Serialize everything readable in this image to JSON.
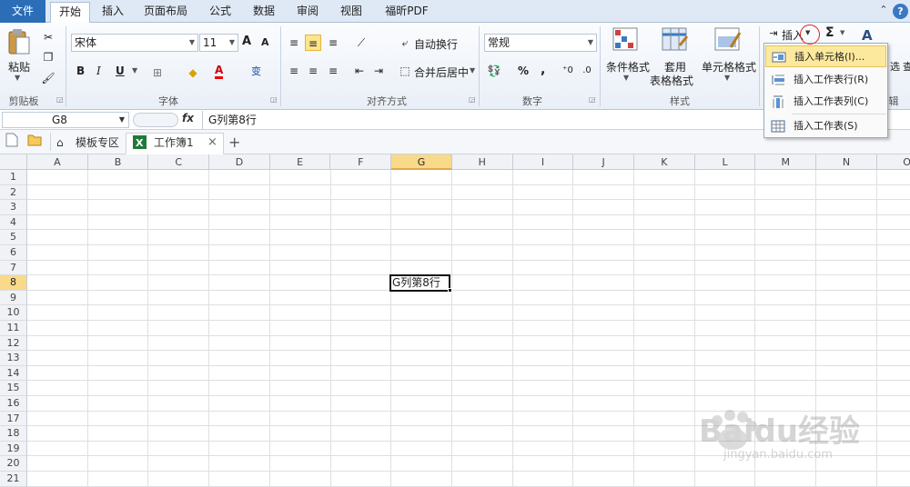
{
  "tabs": {
    "file": "文件",
    "items": [
      "开始",
      "插入",
      "页面布局",
      "公式",
      "数据",
      "审阅",
      "视图",
      "福昕PDF"
    ],
    "active_index": 0
  },
  "ribbon": {
    "clipboard": {
      "paste": "粘贴",
      "label": "剪贴板"
    },
    "font": {
      "name": "宋体",
      "size": "11",
      "label": "字体",
      "bold": "B",
      "italic": "I",
      "underline": "U",
      "grow": "A",
      "shrink": "A",
      "color_a": "A",
      "wen": "变"
    },
    "alignment": {
      "wrap": "自动换行",
      "merge": "合并后居中",
      "label": "对齐方式"
    },
    "number": {
      "format": "常规",
      "percent": "%",
      "comma": ",",
      "label": "数字"
    },
    "styles": {
      "conditional": "条件格式",
      "table1": "套用",
      "table2": "表格格式",
      "cell": "单元格格式",
      "label": "样式"
    },
    "cells": {
      "insert": "插入",
      "sigma": "Σ"
    },
    "editing": {
      "partial1": "选",
      "partial2": "查",
      "label_partial": "辑"
    }
  },
  "menu": {
    "items": [
      {
        "label": "插入单元格(I)...",
        "icon": "insert-cells-icon"
      },
      {
        "label": "插入工作表行(R)",
        "icon": "insert-row-icon"
      },
      {
        "label": "插入工作表列(C)",
        "icon": "insert-column-icon"
      },
      {
        "label": "插入工作表(S)",
        "icon": "insert-sheet-icon"
      }
    ],
    "highlighted_index": 0
  },
  "formula_bar": {
    "cell_ref": "G8",
    "fx": "fx",
    "content": "G列第8行"
  },
  "doc_tabs": {
    "template": "模板专区",
    "workbook": "工作簿1",
    "close": "×",
    "add": "+"
  },
  "grid": {
    "columns": [
      "A",
      "B",
      "C",
      "D",
      "E",
      "F",
      "G",
      "H",
      "I",
      "J",
      "K",
      "L",
      "M",
      "N",
      "O"
    ],
    "rows": [
      "1",
      "2",
      "3",
      "4",
      "5",
      "6",
      "7",
      "8",
      "9",
      "10",
      "11",
      "12",
      "13",
      "14",
      "15",
      "16",
      "17",
      "18",
      "19",
      "20",
      "21"
    ],
    "selected_column": "G",
    "selected_row": "8",
    "active_cell_value": "G列第8行"
  },
  "watermark": {
    "line1": "Baidu经验",
    "line2": "jingyan.baidu.com"
  },
  "colors": {
    "file_tab": "#2b6db7",
    "selection": "#f9d98a",
    "menu_highlight": "#fde99d",
    "highlight_circle": "#e02020"
  }
}
